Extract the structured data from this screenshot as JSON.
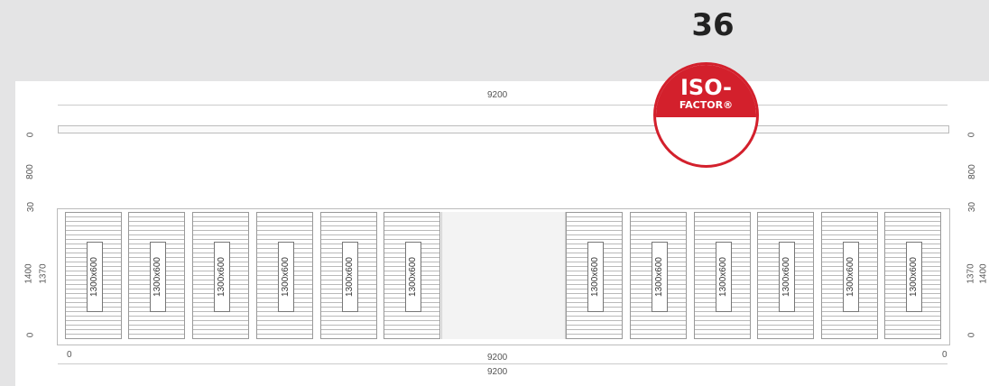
{
  "header": {
    "number": "36"
  },
  "badge": {
    "line1": "ISO-",
    "line2": "FACTOR®"
  },
  "drawing": {
    "top_width": "9200",
    "bottom_width_1": "9200",
    "bottom_width_2": "9200",
    "left_labels": {
      "top_zero": "0",
      "gap": "800",
      "thirty": "30",
      "total": "1400",
      "inner": "1370",
      "bottom_zero": "0",
      "x_zero": "0"
    },
    "right_labels": {
      "top_zero": "0",
      "gap": "800",
      "thirty": "30",
      "total": "1400",
      "inner": "1370",
      "bottom_zero": "0",
      "x_zero": "0"
    },
    "panels": [
      "1300x600",
      "1300x600",
      "1300x600",
      "1300x600",
      "1300x600",
      "1300x600",
      "1300x600",
      "1300x600",
      "1300x600",
      "1300x600",
      "1300x600",
      "1300x600"
    ]
  },
  "colors": {
    "badge_red": "#d3202c",
    "background": "#e4e4e5",
    "sheet": "#ffffff"
  }
}
